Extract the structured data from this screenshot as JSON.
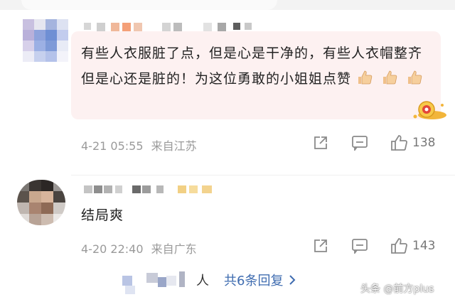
{
  "comments": [
    {
      "text": "有些人衣服脏了点，但是心是干净的，有些人衣帽整齐但是心还是脏的！为这位勇敢的小姐姐点赞",
      "reaction_emoji": "👍",
      "time": "4-21 05:55",
      "location": "来自江苏",
      "likes": "138"
    },
    {
      "text": "结局爽",
      "time": "4-20 22:40",
      "location": "来自广东",
      "likes": "143"
    }
  ],
  "reply_thread": {
    "prefix": "人",
    "link_label": "共6条回复"
  },
  "watermark": "头条 @前方plus",
  "icons": [
    "share-icon",
    "comment-icon",
    "thumbs-up-icon",
    "chevron-right-icon",
    "gold-coin-badge-icon"
  ],
  "colors": {
    "bubble": "#fdf1f1",
    "link": "#3f6cb0",
    "meta": "#9a9a9a",
    "badge": "#f2b53a"
  }
}
